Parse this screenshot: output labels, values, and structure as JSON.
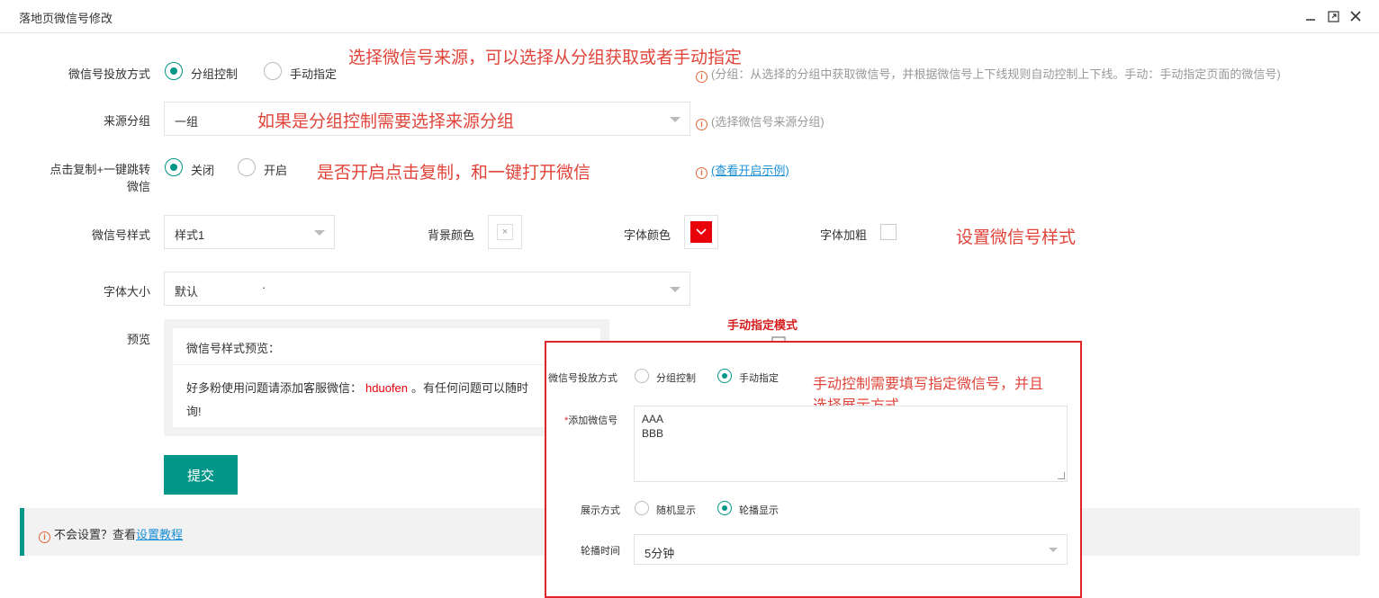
{
  "dialog": {
    "title": "落地页微信号修改"
  },
  "form": {
    "delivery": {
      "label": "微信号投放方式",
      "options": [
        "分组控制",
        "手动指定"
      ],
      "selected": "分组控制",
      "hint": "(分组：从选择的分组中获取微信号，并根据微信号上下线规则自动控制上下线。手动：手动指定页面的微信号)"
    },
    "source_group": {
      "label": "来源分组",
      "value": "一组",
      "hint": "(选择微信号来源分组)"
    },
    "copy_jump": {
      "label_line1": "点击复制+一键跳转",
      "label_line2": "微信",
      "options": [
        "关闭",
        "开启"
      ],
      "selected": "关闭",
      "hint_link": "(查看开启示例)"
    },
    "style": {
      "label": "微信号样式",
      "value": "样式1",
      "bg_color_label": "背景颜色",
      "font_color_label": "字体颜色",
      "font_color": "#e8000b",
      "bold_label": "字体加粗"
    },
    "font_size": {
      "label": "字体大小",
      "value": "默认",
      "extra": "·"
    },
    "preview": {
      "label": "预览",
      "title": "微信号样式预览：",
      "text_before": "好多粉使用问题请添加客服微信：",
      "wechat_id": "hduofen",
      "text_after": "。有任何问题可以随时",
      "text_line2": "询!"
    },
    "submit_label": "提交"
  },
  "tip": {
    "text": "不会设置？查看",
    "link": "设置教程"
  },
  "annotations": {
    "a1": "选择微信号来源，可以选择从分组获取或者手动指定",
    "a2": "如果是分组控制需要选择来源分组",
    "a3": "是否开启点击复制，和一键打开微信",
    "a4": "设置微信号样式",
    "manual_mode_title": "手动指定模式",
    "a5_line1": "手动控制需要填写指定微信号，并且",
    "a5_line2": "选择展示方式"
  },
  "manual_panel": {
    "delivery_label": "微信号投放方式",
    "options": [
      "分组控制",
      "手动指定"
    ],
    "selected": "手动指定",
    "add_label": "添加微信号",
    "add_required_mark": "*",
    "wechat_lines": [
      "AAA",
      "BBB"
    ],
    "display_label": "展示方式",
    "display_options": [
      "随机显示",
      "轮播显示"
    ],
    "display_selected": "轮播显示",
    "interval_label": "轮播时间",
    "interval_value": "5分钟"
  },
  "colors": {
    "accent": "#009688",
    "annotation": "#e0443a",
    "highlight_border": "#e0242c"
  },
  "icons": [
    "minimize-icon",
    "maximize-icon",
    "close-icon",
    "info-icon",
    "chevron-down-icon",
    "down-arrow-icon"
  ]
}
